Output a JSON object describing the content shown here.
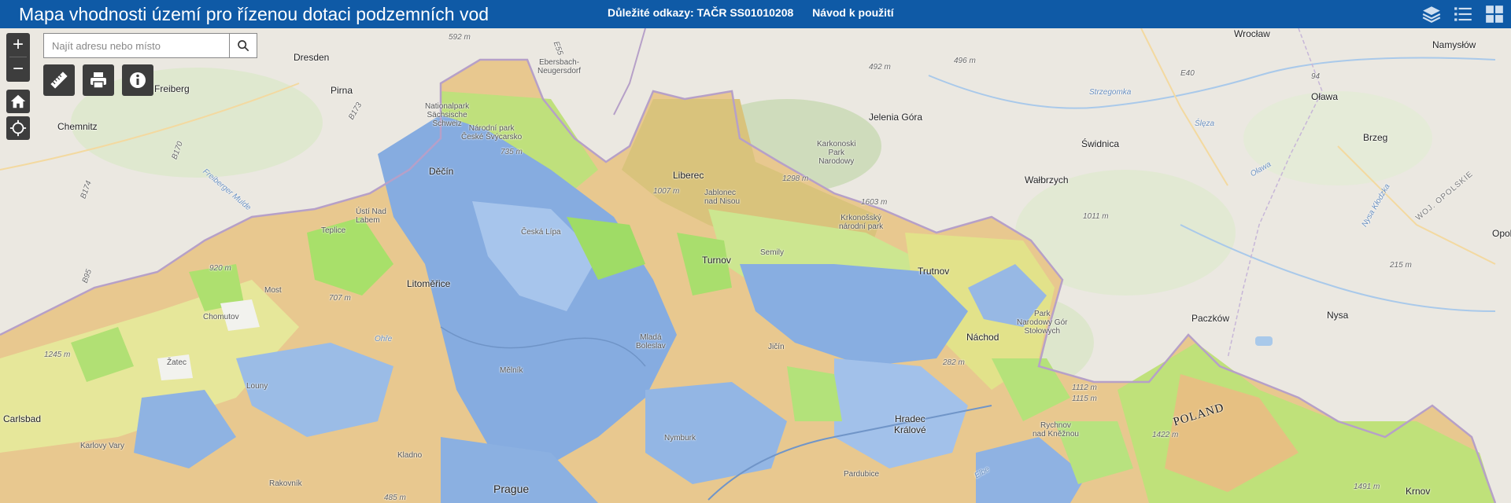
{
  "header": {
    "title": "Mapa vhodnosti území pro řízenou dotaci podzemních vod",
    "links": [
      "Důležité odkazy: TAČR SS01010208",
      "Návod k použití"
    ],
    "icons": [
      "layers-icon",
      "legend-list-icon",
      "basemap-gallery-icon"
    ]
  },
  "search": {
    "placeholder": "Najít adresu nebo místo"
  },
  "controls": {
    "zoom_in": "+",
    "zoom_out": "−",
    "tools": [
      "measure-icon",
      "print-icon",
      "info-icon"
    ],
    "nav": [
      "home-icon",
      "locate-icon"
    ]
  },
  "map_labels": {
    "germany": [
      "Dresden",
      "Pirna",
      "Freiberg",
      "Chemnitz",
      "Ebersbach-\nNeugersdorf",
      "Carlsbad"
    ],
    "czech_cities": [
      "Děčín",
      "Ústí Nad\nLabem",
      "Teplice",
      "Most",
      "Chomutov",
      "Litoměřice",
      "Liberec",
      "Jablonec\nnad Nisou",
      "Turnov",
      "Trutnov",
      "Náchod",
      "Mladá\nBoleslav",
      "Hradec\nKrálové",
      "Kladno",
      "Prague",
      "Jičín",
      "Mělník",
      "Česká Lípa",
      "Louny",
      "Rakovník",
      "Nymburk",
      "Pardubice",
      "Semily",
      "Rychnov\nnad Kněžnou",
      "Karlovy Vary",
      "Žatec"
    ],
    "parks": [
      "Národní park\nČeské Švýcarsko",
      "Nationalpark\nSächsische\nSchweiz",
      "Karkonoski\nPark\nNarodowy",
      "Krkonošský\nnárodní park",
      "Park\nNarodowy Gór\nStołowych"
    ],
    "poland": [
      "Wrocław",
      "Namysłów",
      "Oława",
      "Jelenia Góra",
      "Świdnica",
      "Wałbrzych",
      "Brzeg",
      "Paczków",
      "Nysa",
      "Krnov",
      "Opole"
    ],
    "country": "POLAND",
    "region": "WOJ. OPOLSKIE",
    "rivers": [
      "Freiberger Mulde",
      "Strzegomka",
      "Ślęza",
      "Oława",
      "Nysa Kłodzka",
      "Ohře",
      "Elbe"
    ],
    "elevations": [
      "592 m",
      "492 m",
      "496 m",
      "735 m",
      "1007 m",
      "1298 m",
      "1603 m",
      "920 m",
      "707 m",
      "1245 m",
      "1011 m",
      "215 m",
      "282 m",
      "1112 m",
      "1115 m",
      "1422 m",
      "1491 m",
      "485 m"
    ],
    "roads": [
      "94",
      "E40",
      "B170",
      "B173",
      "B174",
      "B95",
      "E55"
    ]
  },
  "colors": {
    "header": "#0f5aa6",
    "basemap": "#e9e6df",
    "suitable_blue": "#7fa7dd",
    "suitable_light_blue": "#a9c7ec",
    "moderate_green": "#a7e36a",
    "low_yellow": "#ecec9a",
    "unsuitable_orange": "#e8b877",
    "control_dark": "#3d3d3d"
  }
}
